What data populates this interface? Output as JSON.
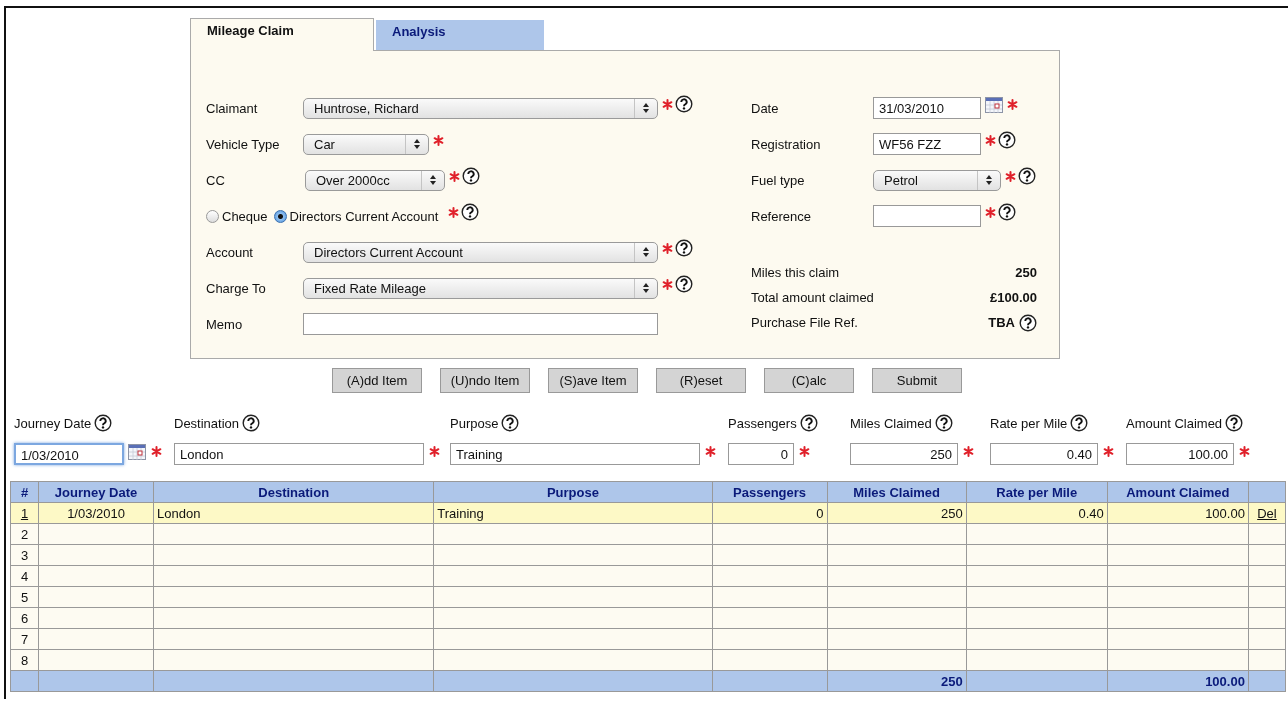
{
  "tabs": [
    {
      "label": "Mileage Claim",
      "selected": true
    },
    {
      "label": "Analysis",
      "selected": false
    }
  ],
  "form": {
    "left": [
      {
        "kind": "select",
        "label": "Claimant",
        "value": "Huntrose, Richard",
        "required": true,
        "help": true
      },
      {
        "kind": "select",
        "label": "Vehicle Type",
        "value": "Car",
        "required": true,
        "help": false
      },
      {
        "kind": "select",
        "label": "CC",
        "value": "Over 2000cc",
        "required": true,
        "help": true
      },
      {
        "kind": "radio",
        "options": [
          {
            "label": "Cheque",
            "selected": false
          },
          {
            "label": "Directors Current Account",
            "selected": true
          }
        ],
        "required": true,
        "help": true
      },
      {
        "kind": "select",
        "label": "Account",
        "value": "Directors Current Account",
        "required": true,
        "help": true
      },
      {
        "kind": "select",
        "label": "Charge To",
        "value": "Fixed Rate Mileage",
        "required": true,
        "help": true
      },
      {
        "kind": "text",
        "label": "Memo",
        "required": false,
        "help": false
      }
    ],
    "right": [
      {
        "kind": "date",
        "label": "Date",
        "value": "31/03/2010",
        "required": true,
        "help": false
      },
      {
        "kind": "text",
        "label": "Registration",
        "value": "WF56 FZZ",
        "required": true,
        "help": true
      },
      {
        "kind": "select",
        "label": "Fuel type",
        "value": "Petrol",
        "required": true,
        "help": true
      },
      {
        "kind": "text",
        "label": "Reference",
        "required": true,
        "help": true
      }
    ],
    "summary": [
      {
        "label": "Miles this claim",
        "value": "250",
        "help": false
      },
      {
        "label": "Total amount claimed",
        "value": "£100.00",
        "help": false
      },
      {
        "label": "Purchase File Ref.",
        "value": "TBA",
        "help": true
      }
    ]
  },
  "buttons": [
    "(A)dd Item",
    "(U)ndo Item",
    "(S)ave Item",
    "(R)eset",
    "(C)alc",
    "Submit"
  ],
  "entry": [
    {
      "kind": "date",
      "label": "Journey Date",
      "value": "1/03/2010",
      "focused": true,
      "required": true,
      "help": true
    },
    {
      "kind": "text",
      "label": "Destination",
      "value": "London",
      "focused": false,
      "required": true,
      "help": true
    },
    {
      "kind": "text",
      "label": "Purpose",
      "value": "Training",
      "focused": false,
      "required": true,
      "help": true
    },
    {
      "kind": "number",
      "label": "Passengers",
      "value": "0",
      "focused": false,
      "required": true,
      "help": true
    },
    {
      "kind": "number",
      "label": "Miles Claimed",
      "value": "250",
      "focused": false,
      "required": true,
      "help": true
    },
    {
      "kind": "number",
      "label": "Rate per Mile",
      "value": "0.40",
      "focused": false,
      "required": true,
      "help": true
    },
    {
      "kind": "number",
      "label": "Amount Claimed",
      "value": "100.00",
      "focused": false,
      "required": true,
      "help": true
    }
  ],
  "table": {
    "columns": [
      "#",
      "Journey Date",
      "Destination",
      "Purpose",
      "Passengers",
      "Miles Claimed",
      "Rate per Mile",
      "Amount Claimed"
    ],
    "rows": [
      {
        "number": "1",
        "selected": true,
        "cells": [
          "1/03/2010",
          "London",
          "Training",
          "0",
          "250",
          "0.40",
          "100.00"
        ],
        "action": "Del"
      },
      {
        "number": "2",
        "selected": false
      },
      {
        "number": "3",
        "selected": false
      },
      {
        "number": "4",
        "selected": false
      },
      {
        "number": "5",
        "selected": false
      },
      {
        "number": "6",
        "selected": false
      },
      {
        "number": "7",
        "selected": false
      },
      {
        "number": "8",
        "selected": false
      }
    ],
    "totals": {
      "miles_claimed": "250",
      "amount_claimed": "100.00"
    }
  }
}
